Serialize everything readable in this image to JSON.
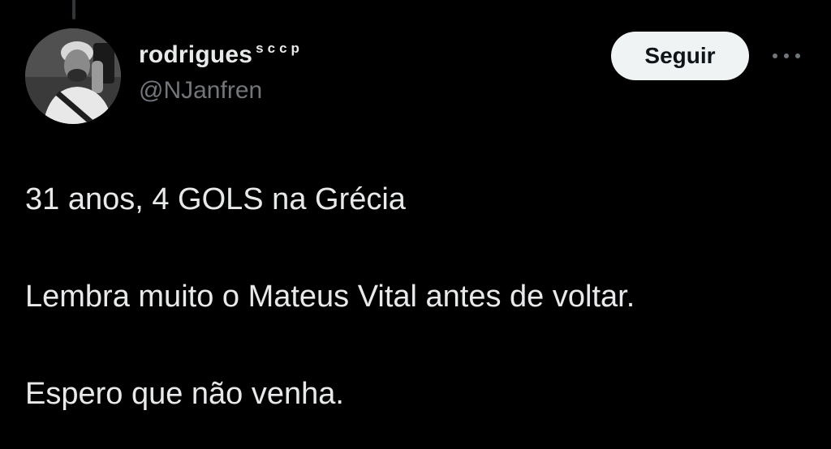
{
  "tweet": {
    "author": {
      "display_name": "rodrigues",
      "name_suffix": "sccp",
      "handle": "@NJanfren"
    },
    "follow_label": "Seguir",
    "more_icon": "more-horizontal-icon",
    "paragraphs": [
      "31 anos, 4 GOLS na Grécia",
      "Lembra muito o Mateus Vital antes de voltar.",
      "Espero que não venha."
    ]
  },
  "colors": {
    "background": "#000000",
    "text_primary": "#e7e9ea",
    "text_secondary": "#71767b",
    "button_bg": "#eff3f4",
    "button_text": "#0f1419"
  }
}
